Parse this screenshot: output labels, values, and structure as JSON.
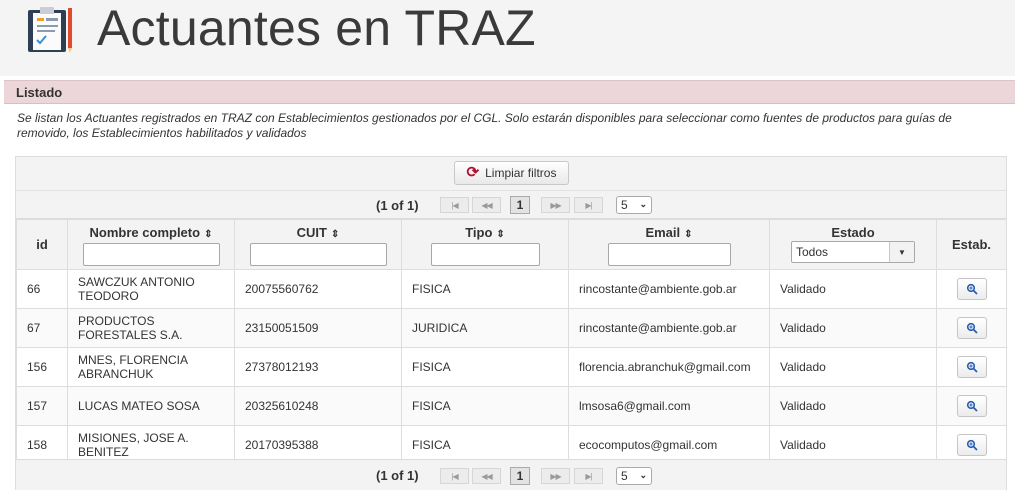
{
  "header": {
    "title": "Actuantes en TRAZ",
    "icon": "clipboard-icon"
  },
  "panel": {
    "title": "Listado",
    "description": "Se listan los Actuantes registrados en TRAZ con Establecimientos gestionados por el CGL. Solo estarán disponibles para seleccionar como fuentes de productos para guías de removido, los Establecimientos habilitados y validados"
  },
  "toolbar": {
    "clear_label": "Limpiar filtros",
    "clear_icon": "refresh-icon",
    "accent": "#b0112c"
  },
  "paginator": {
    "current": "(1 of 1)",
    "first": "|◀",
    "prev": "◀◀",
    "next": "▶▶",
    "last": "▶|",
    "page": "1",
    "rows_per_page": "5"
  },
  "table": {
    "columns": {
      "id": "id",
      "nombre": "Nombre completo",
      "cuit": "CUIT",
      "tipo": "Tipo",
      "email": "Email",
      "estado": "Estado",
      "estab": "Estab."
    },
    "sort_icon": "⇕",
    "estado_filter": "Todos",
    "rows": [
      {
        "id": "66",
        "nombre": "SAWCZUK ANTONIO TEODORO",
        "cuit": "20075560762",
        "tipo": "FISICA",
        "email": "rincostante@ambiente.gob.ar",
        "estado": "Validado"
      },
      {
        "id": "67",
        "nombre": "PRODUCTOS FORESTALES S.A.",
        "cuit": "23150051509",
        "tipo": "JURIDICA",
        "email": "rincostante@ambiente.gob.ar",
        "estado": "Validado"
      },
      {
        "id": "156",
        "nombre": "MNES, FLORENCIA ABRANCHUK",
        "cuit": "27378012193",
        "tipo": "FISICA",
        "email": "florencia.abranchuk@gmail.com",
        "estado": "Validado"
      },
      {
        "id": "157",
        "nombre": "LUCAS MATEO SOSA",
        "cuit": "20325610248",
        "tipo": "FISICA",
        "email": "lmsosa6@gmail.com",
        "estado": "Validado"
      },
      {
        "id": "158",
        "nombre": "MISIONES, JOSE A. BENITEZ",
        "cuit": "20170395388",
        "tipo": "FISICA",
        "email": "ecocomputos@gmail.com",
        "estado": "Validado"
      }
    ]
  }
}
